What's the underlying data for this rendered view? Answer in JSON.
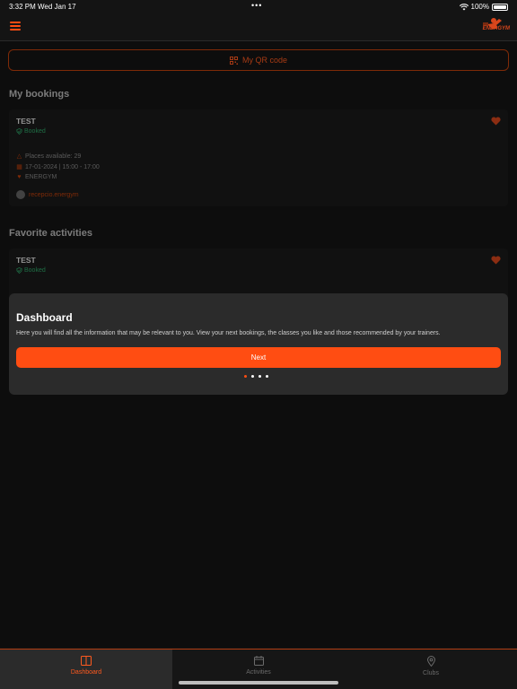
{
  "status_bar": {
    "time": "3:32 PM",
    "date": "Wed Jan 17",
    "dots": "•••",
    "battery": "100%"
  },
  "header": {
    "logo_text": "ENERGYM"
  },
  "qr_button": {
    "label": "My QR code"
  },
  "bookings": {
    "title": "My bookings",
    "card": {
      "title": "TEST",
      "status": "Booked",
      "places": "Places available: 29",
      "datetime": "17-01-2024 | 15:00 - 17:00",
      "club": "ENERGYM",
      "trainer": "recepcio.energym"
    }
  },
  "favorites": {
    "title": "Favorite activities",
    "card": {
      "title": "TEST",
      "status": "Booked"
    }
  },
  "tooltip": {
    "title": "Dashboard",
    "text": "Here you will find all the information that may be relevant to you. View your next bookings, the classes you like and those recommended by your trainers.",
    "next_label": "Next",
    "pages": 4,
    "current_page": 1
  },
  "tabs": [
    {
      "label": "Dashboard",
      "icon": "dashboard-icon",
      "active": true
    },
    {
      "label": "Activities",
      "icon": "calendar-icon",
      "active": false
    },
    {
      "label": "Clubs",
      "icon": "location-pin-icon",
      "active": false
    }
  ],
  "colors": {
    "accent": "#ff4d12",
    "booked": "#2fa86a",
    "background": "#141414"
  }
}
